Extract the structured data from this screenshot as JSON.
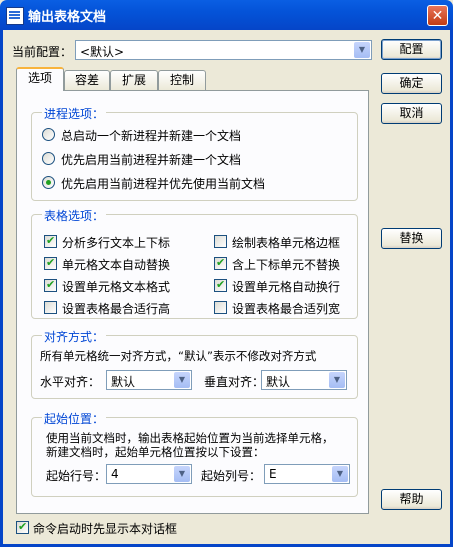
{
  "window": {
    "title": "输出表格文档",
    "close_glyph": "✕"
  },
  "config": {
    "label": "当前配置：",
    "value": "<默认>",
    "button": "配置"
  },
  "tabs": [
    "选项",
    "容差",
    "扩展",
    "控制"
  ],
  "buttons": {
    "ok": "确定",
    "cancel": "取消",
    "replace": "替换",
    "help": "帮助"
  },
  "process": {
    "title": "进程选项：",
    "options": [
      "总启动一个新进程并新建一个文档",
      "优先启用当前进程并新建一个文档",
      "优先启用当前进程并优先使用当前文档"
    ],
    "selected_index": 2
  },
  "table_opts": {
    "title": "表格选项：",
    "items": [
      {
        "label": "分析多行文本上下标",
        "checked": true
      },
      {
        "label": "绘制表格单元格边框",
        "checked": false
      },
      {
        "label": "单元格文本自动替换",
        "checked": true
      },
      {
        "label": "含上下标单元不替换",
        "checked": true
      },
      {
        "label": "设置单元格文本格式",
        "checked": true
      },
      {
        "label": "设置单元格自动换行",
        "checked": true
      },
      {
        "label": "设置表格最合适行高",
        "checked": false
      },
      {
        "label": "设置表格最合适列宽",
        "checked": false
      }
    ]
  },
  "align": {
    "title": "对齐方式：",
    "desc": "所有单元格统一对齐方式，“默认”表示不修改对齐方式",
    "h_label": "水平对齐：",
    "h_value": "默认",
    "v_label": "垂直对齐：",
    "v_value": "默认"
  },
  "start": {
    "title": "起始位置：",
    "desc1": "使用当前文档时，输出表格起始位置为当前选择单元格，",
    "desc2": "新建文档时，起始单元格位置按以下设置：",
    "row_label": "起始行号：",
    "row_value": "4",
    "col_label": "起始列号：",
    "col_value": "E"
  },
  "footer": {
    "label": "命令启动时先显示本对话框",
    "checked": true
  }
}
